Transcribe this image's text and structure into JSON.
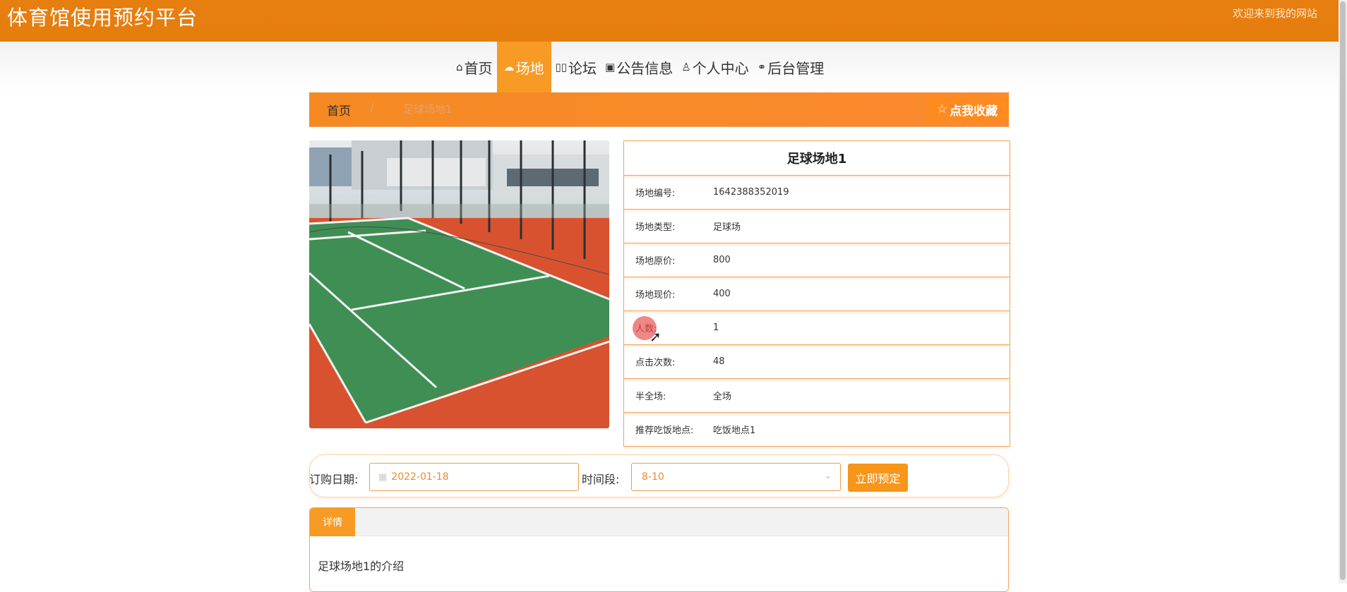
{
  "header": {
    "site_title": "体育馆使用预约平台",
    "welcome": "欢迎来到我的网站"
  },
  "nav": {
    "items": [
      {
        "icon": "home-icon",
        "glyph": "⌂",
        "label": "首页",
        "active": false
      },
      {
        "icon": "cloud-icon",
        "glyph": "☁",
        "label": "场地",
        "active": true
      },
      {
        "icon": "forum-icon",
        "glyph": "▯▯",
        "label": "论坛",
        "active": false
      },
      {
        "icon": "gift-icon",
        "glyph": "▣",
        "label": "公告信息",
        "active": false
      },
      {
        "icon": "user-icon",
        "glyph": "♙",
        "label": "个人中心",
        "active": false
      },
      {
        "icon": "link-icon",
        "glyph": "⚭",
        "label": "后台管理",
        "active": false
      }
    ]
  },
  "breadcrumb": {
    "home": "首页",
    "separator": "/",
    "current": "足球场地1",
    "favorite_label": "点我收藏"
  },
  "venue": {
    "title": "足球场地1",
    "fields": [
      {
        "key": "场地编号:",
        "value": "1642388352019"
      },
      {
        "key": "场地类型:",
        "value": "足球场"
      },
      {
        "key": "场地原价:",
        "value": "800"
      },
      {
        "key": "场地现价:",
        "value": "400"
      },
      {
        "key": "人数:",
        "value": "1"
      },
      {
        "key": "点击次数:",
        "value": "48"
      },
      {
        "key": "半全场:",
        "value": "全场"
      },
      {
        "key": "推荐吃饭地点:",
        "value": "吃饭地点1"
      }
    ]
  },
  "booking": {
    "date_label": "订购日期:",
    "date_value": "2022-01-18",
    "time_label": "时间段:",
    "time_value": "8-10",
    "submit_label": "立即预定"
  },
  "detail": {
    "tab_label": "详情",
    "content": "足球场地1的介绍"
  },
  "colors": {
    "brand": "#e77e10",
    "accent": "#f79b24",
    "border": "#f7a35a"
  }
}
